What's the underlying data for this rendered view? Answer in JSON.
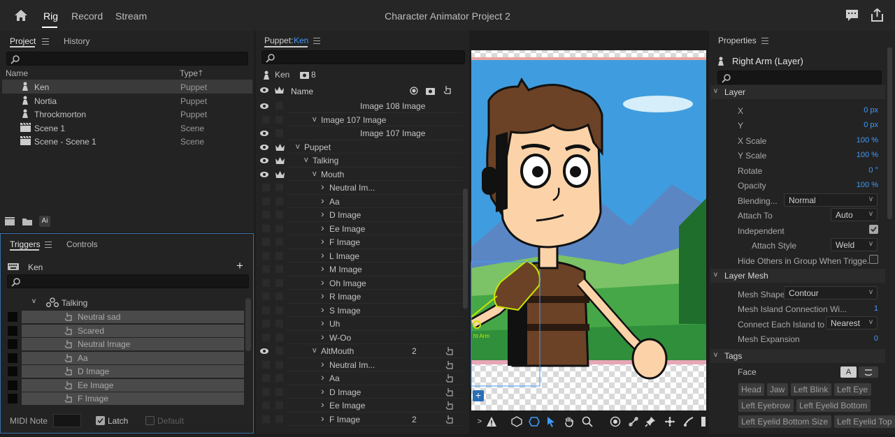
{
  "app": {
    "title": "Character Animator Project 2",
    "modes": [
      "Rig",
      "Record",
      "Stream"
    ],
    "active_mode": "Rig"
  },
  "project_panel": {
    "tabs": [
      "Project",
      "History"
    ],
    "columns": [
      "Name",
      "Type"
    ],
    "items": [
      {
        "name": "Ken",
        "type": "Puppet",
        "icon": "puppet-icon"
      },
      {
        "name": "Nortia",
        "type": "Puppet",
        "icon": "puppet-icon"
      },
      {
        "name": "Throckmorton",
        "type": "Puppet",
        "icon": "puppet-icon"
      },
      {
        "name": "Scene 1",
        "type": "Scene",
        "icon": "scene-icon"
      },
      {
        "name": "Scene - Scene 1",
        "type": "Scene",
        "icon": "scene-icon"
      }
    ],
    "footer_badge": "Ai"
  },
  "triggers_panel": {
    "tabs": [
      "Triggers",
      "Controls"
    ],
    "puppet_name": "Ken",
    "group": "Talking",
    "triggers": [
      "Neutral sad",
      "Scared",
      "Neutral Image",
      "Aa",
      "D Image",
      "Ee Image",
      "F Image"
    ],
    "midi_note_label": "MIDI Note",
    "latch_label": "Latch",
    "default_label": "Default"
  },
  "puppet_panel": {
    "title_prefix": "Puppet:",
    "title_name": "Ken",
    "puppet_name": "Ken",
    "count": "8",
    "column_name": "Name",
    "layers": [
      {
        "name": "Image 108 Image",
        "indent": 3,
        "chev": "",
        "eye": true,
        "crown": false,
        "num": ""
      },
      {
        "name": "Image 107 Image",
        "indent": 2,
        "chev": "v",
        "eye": false,
        "crown": false,
        "num": ""
      },
      {
        "name": "Image 107 Image",
        "indent": 3,
        "chev": "",
        "eye": true,
        "crown": false,
        "num": ""
      },
      {
        "name": "Puppet",
        "indent": 0,
        "chev": "v",
        "eye": true,
        "crown": true,
        "num": ""
      },
      {
        "name": "Talking",
        "indent": 1,
        "chev": "v",
        "eye": true,
        "crown": true,
        "num": ""
      },
      {
        "name": "Mouth",
        "indent": 2,
        "chev": "v",
        "eye": true,
        "crown": true,
        "num": ""
      },
      {
        "name": "Neutral Im...",
        "indent": 3,
        "chev": ">",
        "eye": false,
        "crown": false,
        "num": ""
      },
      {
        "name": "Aa",
        "indent": 3,
        "chev": ">",
        "eye": false,
        "crown": false,
        "num": ""
      },
      {
        "name": "D Image",
        "indent": 3,
        "chev": ">",
        "eye": false,
        "crown": false,
        "num": ""
      },
      {
        "name": "Ee Image",
        "indent": 3,
        "chev": ">",
        "eye": false,
        "crown": false,
        "num": ""
      },
      {
        "name": "F Image",
        "indent": 3,
        "chev": ">",
        "eye": false,
        "crown": false,
        "num": ""
      },
      {
        "name": "L Image",
        "indent": 3,
        "chev": ">",
        "eye": false,
        "crown": false,
        "num": ""
      },
      {
        "name": "M Image",
        "indent": 3,
        "chev": ">",
        "eye": false,
        "crown": false,
        "num": ""
      },
      {
        "name": "Oh Image",
        "indent": 3,
        "chev": ">",
        "eye": false,
        "crown": false,
        "num": ""
      },
      {
        "name": "R Image",
        "indent": 3,
        "chev": ">",
        "eye": false,
        "crown": false,
        "num": ""
      },
      {
        "name": "S Image",
        "indent": 3,
        "chev": ">",
        "eye": false,
        "crown": false,
        "num": ""
      },
      {
        "name": "Uh",
        "indent": 3,
        "chev": ">",
        "eye": false,
        "crown": false,
        "num": ""
      },
      {
        "name": "W-Oo",
        "indent": 3,
        "chev": ">",
        "eye": false,
        "crown": false,
        "num": ""
      },
      {
        "name": "AltMouth",
        "indent": 2,
        "chev": "v",
        "eye": true,
        "crown": false,
        "num": "2"
      },
      {
        "name": "Neutral Im...",
        "indent": 3,
        "chev": ">",
        "eye": false,
        "crown": false,
        "num": ""
      },
      {
        "name": "Aa",
        "indent": 3,
        "chev": ">",
        "eye": false,
        "crown": false,
        "num": ""
      },
      {
        "name": "D Image",
        "indent": 3,
        "chev": ">",
        "eye": false,
        "crown": false,
        "num": ""
      },
      {
        "name": "Ee Image",
        "indent": 3,
        "chev": ">",
        "eye": false,
        "crown": false,
        "num": ""
      },
      {
        "name": "F Image",
        "indent": 3,
        "chev": ">",
        "eye": false,
        "crown": false,
        "num": "2"
      }
    ]
  },
  "canvas": {
    "handle_label": "ht Arm"
  },
  "properties": {
    "tab": "Properties",
    "layer_title": "Right Arm (Layer)",
    "section_layer": "Layer",
    "x_label": "X",
    "x_value": "0 px",
    "y_label": "Y",
    "y_value": "0 px",
    "xscale_label": "X Scale",
    "xscale_value": "100 %",
    "yscale_label": "Y Scale",
    "yscale_value": "100 %",
    "rotate_label": "Rotate",
    "rotate_value": "0 °",
    "opacity_label": "Opacity",
    "opacity_value": "100 %",
    "blending_label": "Blending...",
    "blending_value": "Normal",
    "attach_to_label": "Attach To",
    "attach_to_value": "Auto",
    "independent_label": "Independent",
    "attach_style_label": "Attach Style",
    "attach_style_value": "Weld",
    "hide_others_label": "Hide Others in Group When Trigge...",
    "section_mesh": "Layer Mesh",
    "mesh_shape_label": "Mesh Shape",
    "mesh_shape_value": "Contour",
    "mesh_island_label": "Mesh Island Connection Wi...",
    "mesh_island_value": "1",
    "connect_label": "Connect Each Island to",
    "connect_value": "Nearest",
    "expansion_label": "Mesh Expansion",
    "expansion_value": "0",
    "section_tags": "Tags",
    "tags_group": "Face",
    "tags_button": "A",
    "tags": [
      "Head",
      "Jaw",
      "Left Blink",
      "Left Eye",
      "Left Eyebrow",
      "Left Eyelid Bottom",
      "Left Eyelid Bottom Size",
      "Left Eyelid Top"
    ]
  },
  "colors": {
    "accent": "#3f9bff",
    "sky": "#3e9ee0",
    "grass": "#3a9a3a",
    "handle": "#c8e600"
  }
}
